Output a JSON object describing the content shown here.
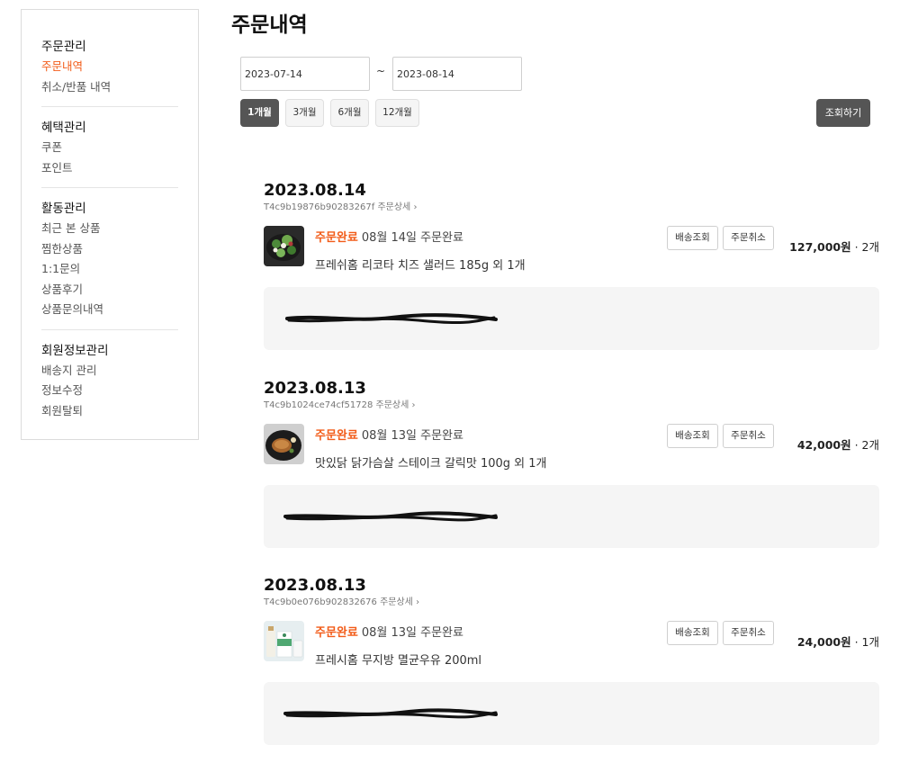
{
  "sidebar": {
    "groups": [
      {
        "title": "주문관리",
        "items": [
          "주문내역",
          "취소/반품 내역"
        ]
      },
      {
        "title": "혜택관리",
        "items": [
          "쿠폰",
          "포인트"
        ]
      },
      {
        "title": "활동관리",
        "items": [
          "최근 본 상품",
          "찜한상품",
          "1:1문의",
          "상품후기",
          "상품문의내역"
        ]
      },
      {
        "title": "회원정보관리",
        "items": [
          "배송지 관리",
          "정보수정",
          "회원탈퇴"
        ]
      }
    ],
    "active_item": "주문내역"
  },
  "page_title": "주문내역",
  "filter": {
    "start_date": "2023-07-14",
    "end_date": "2023-08-14",
    "separator": "~",
    "periods": [
      "1개월",
      "3개월",
      "6개월",
      "12개월"
    ],
    "active_period": "1개월",
    "search_label": "조회하기"
  },
  "orders": [
    {
      "date": "2023.08.14",
      "order_no": "T4c9b19876b90283267f",
      "detail_label": "주문상세",
      "status": "주문완료",
      "status_date": "08월 14일 주문완료",
      "product": "프레쉬홈 리코타 치즈 샐러드 185g 외 1개",
      "track_label": "배송조회",
      "cancel_label": "주문취소",
      "price": "127,000원",
      "quantity": "· 2개",
      "thumb_icon": "salad-image"
    },
    {
      "date": "2023.08.13",
      "order_no": "T4c9b1024ce74cf51728",
      "detail_label": "주문상세",
      "status": "주문완료",
      "status_date": "08월 13일 주문완료",
      "product": "맛있닭 닭가슴살 스테이크 갈릭맛 100g 외 1개",
      "track_label": "배송조회",
      "cancel_label": "주문취소",
      "price": "42,000원",
      "quantity": "· 2개",
      "thumb_icon": "chicken-steak-image"
    },
    {
      "date": "2023.08.13",
      "order_no": "T4c9b0e076b902832676",
      "detail_label": "주문상세",
      "status": "주문완료",
      "status_date": "08월 13일 주문완료",
      "product": "프레시홈 무지방 멸균우유 200ml",
      "track_label": "배송조회",
      "cancel_label": "주문취소",
      "price": "24,000원",
      "quantity": "· 1개",
      "thumb_icon": "milk-image"
    }
  ],
  "colors": {
    "accent": "#f25c19",
    "dark_button": "#555555",
    "address_bg": "#f5f5f5"
  }
}
